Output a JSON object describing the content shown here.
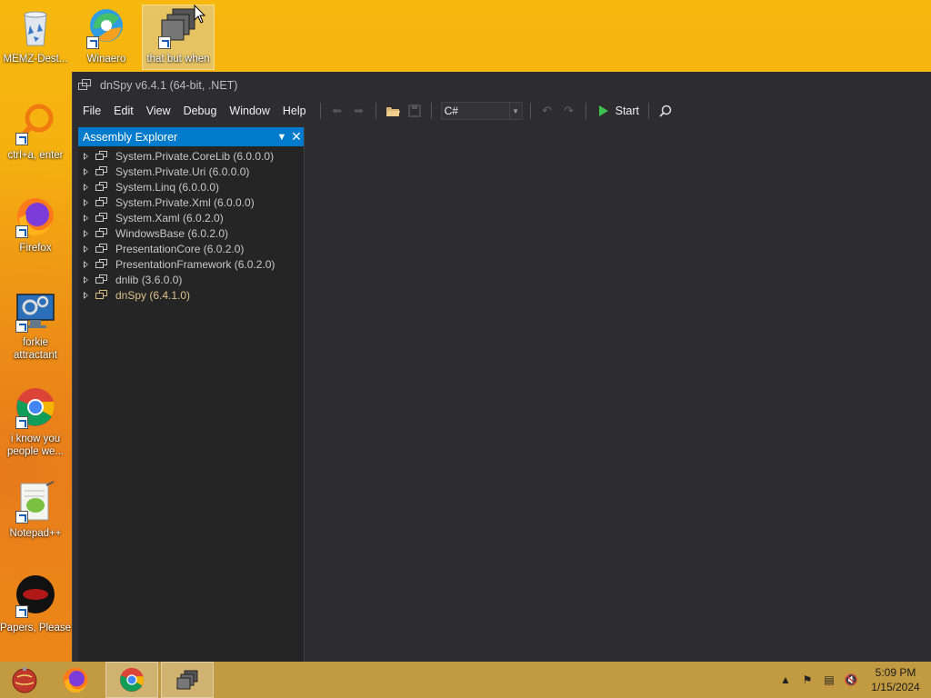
{
  "desktop": {
    "icons": [
      {
        "label": "MEMZ-Dest...",
        "icon": "recycle-bin-icon"
      },
      {
        "label": "Winaero",
        "icon": "winaero-icon"
      },
      {
        "label": "that but when",
        "icon": "dnspy-shortcut-icon"
      },
      {
        "label": "ctrl+a, enter",
        "icon": "magnifier-icon"
      },
      {
        "label": "Firefox",
        "icon": "firefox-icon"
      },
      {
        "label": "forkie attractant",
        "icon": "settings-monitor-icon"
      },
      {
        "label": "i know you people we...",
        "icon": "chrome-icon"
      },
      {
        "label": "Notepad++",
        "icon": "notepadpp-icon"
      },
      {
        "label": "Papers, Please",
        "icon": "papers-please-icon"
      }
    ]
  },
  "window": {
    "title": "dnSpy v6.4.1 (64-bit, .NET)",
    "menu": [
      "File",
      "Edit",
      "View",
      "Debug",
      "Window",
      "Help"
    ],
    "language": "C#",
    "start_label": "Start"
  },
  "assembly_explorer": {
    "title": "Assembly Explorer",
    "items": [
      {
        "label": "System.Private.CoreLib (6.0.0.0)",
        "highlight": false
      },
      {
        "label": "System.Private.Uri (6.0.0.0)",
        "highlight": false
      },
      {
        "label": "System.Linq (6.0.0.0)",
        "highlight": false
      },
      {
        "label": "System.Private.Xml (6.0.0.0)",
        "highlight": false
      },
      {
        "label": "System.Xaml (6.0.2.0)",
        "highlight": false
      },
      {
        "label": "WindowsBase (6.0.2.0)",
        "highlight": false
      },
      {
        "label": "PresentationCore (6.0.2.0)",
        "highlight": false
      },
      {
        "label": "PresentationFramework (6.0.2.0)",
        "highlight": false
      },
      {
        "label": "dnlib (3.6.0.0)",
        "highlight": false
      },
      {
        "label": "dnSpy (6.4.1.0)",
        "highlight": true
      }
    ]
  },
  "taskbar": {
    "apps": [
      "start-orb-icon",
      "firefox-icon",
      "chrome-icon",
      "dnspy-icon"
    ],
    "time": "5:09 PM",
    "date": "1/15/2024"
  },
  "colors": {
    "accent": "#007acc",
    "window_bg": "#2d2d30",
    "panel_bg": "#252526",
    "taskbar": "#c29a42",
    "highlight_item": "#dcc18a"
  }
}
